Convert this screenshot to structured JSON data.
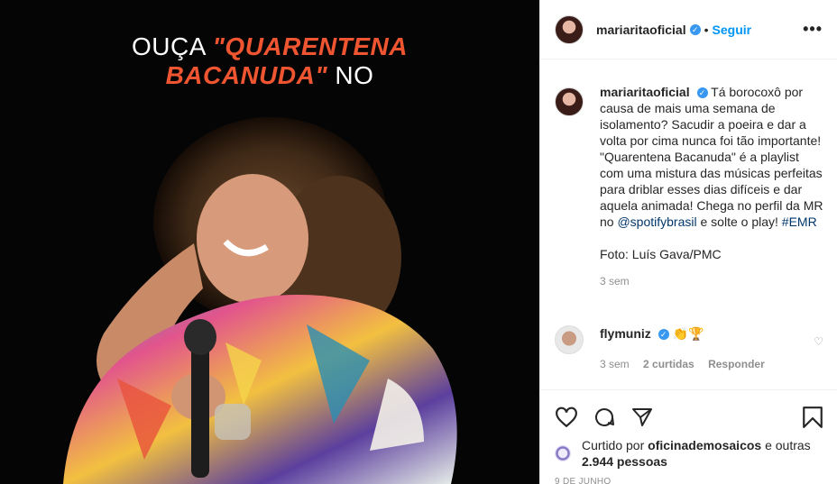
{
  "photo": {
    "headline_line1_white": "OUÇA ",
    "headline_line1_orange": "\"QUARENTENA",
    "headline_line2_orange": "BACANUDA\"",
    "headline_line2_white": " NO",
    "accent_color": "#ef5530"
  },
  "header": {
    "username": "mariaritaoficial",
    "verified_glyph": "✓",
    "dot": "•",
    "follow_label": "Seguir",
    "more_label": "•••"
  },
  "caption": {
    "username": "mariaritaoficial",
    "verified_glyph": "✓",
    "text_part1": "Tá borocoxô por causa de mais uma semana de isolamento? Sacudir a poeira e dar a volta por cima nunca foi tão importante! \"Quarentena Bacanuda\" é a playlist com uma mistura das músicas perfeitas para driblar esses dias difíceis e dar aquela animada! Chega no perfil da MR no ",
    "mention": "@spotifybrasil",
    "text_part2": " e solte o play! ",
    "hashtag": "#EMR",
    "credit": "Foto: Luís Gava/PMC",
    "time": "3 sem"
  },
  "reply": {
    "username": "flymuniz",
    "verified_glyph": "✓",
    "emojis": "👏🏆",
    "time": "3 sem",
    "likes": "2 curtidas",
    "reply_label": "Responder",
    "heart_glyph": "♡"
  },
  "actions": {
    "liked_by_prefix": "Curtido por ",
    "liked_by_user": "oficinademosaicos",
    "liked_by_mid": " e outras ",
    "liked_by_count": "2.944 pessoas",
    "date": "9 DE JUNHO"
  },
  "icons": [
    "heart-icon",
    "comment-icon",
    "share-icon",
    "bookmark-icon"
  ]
}
